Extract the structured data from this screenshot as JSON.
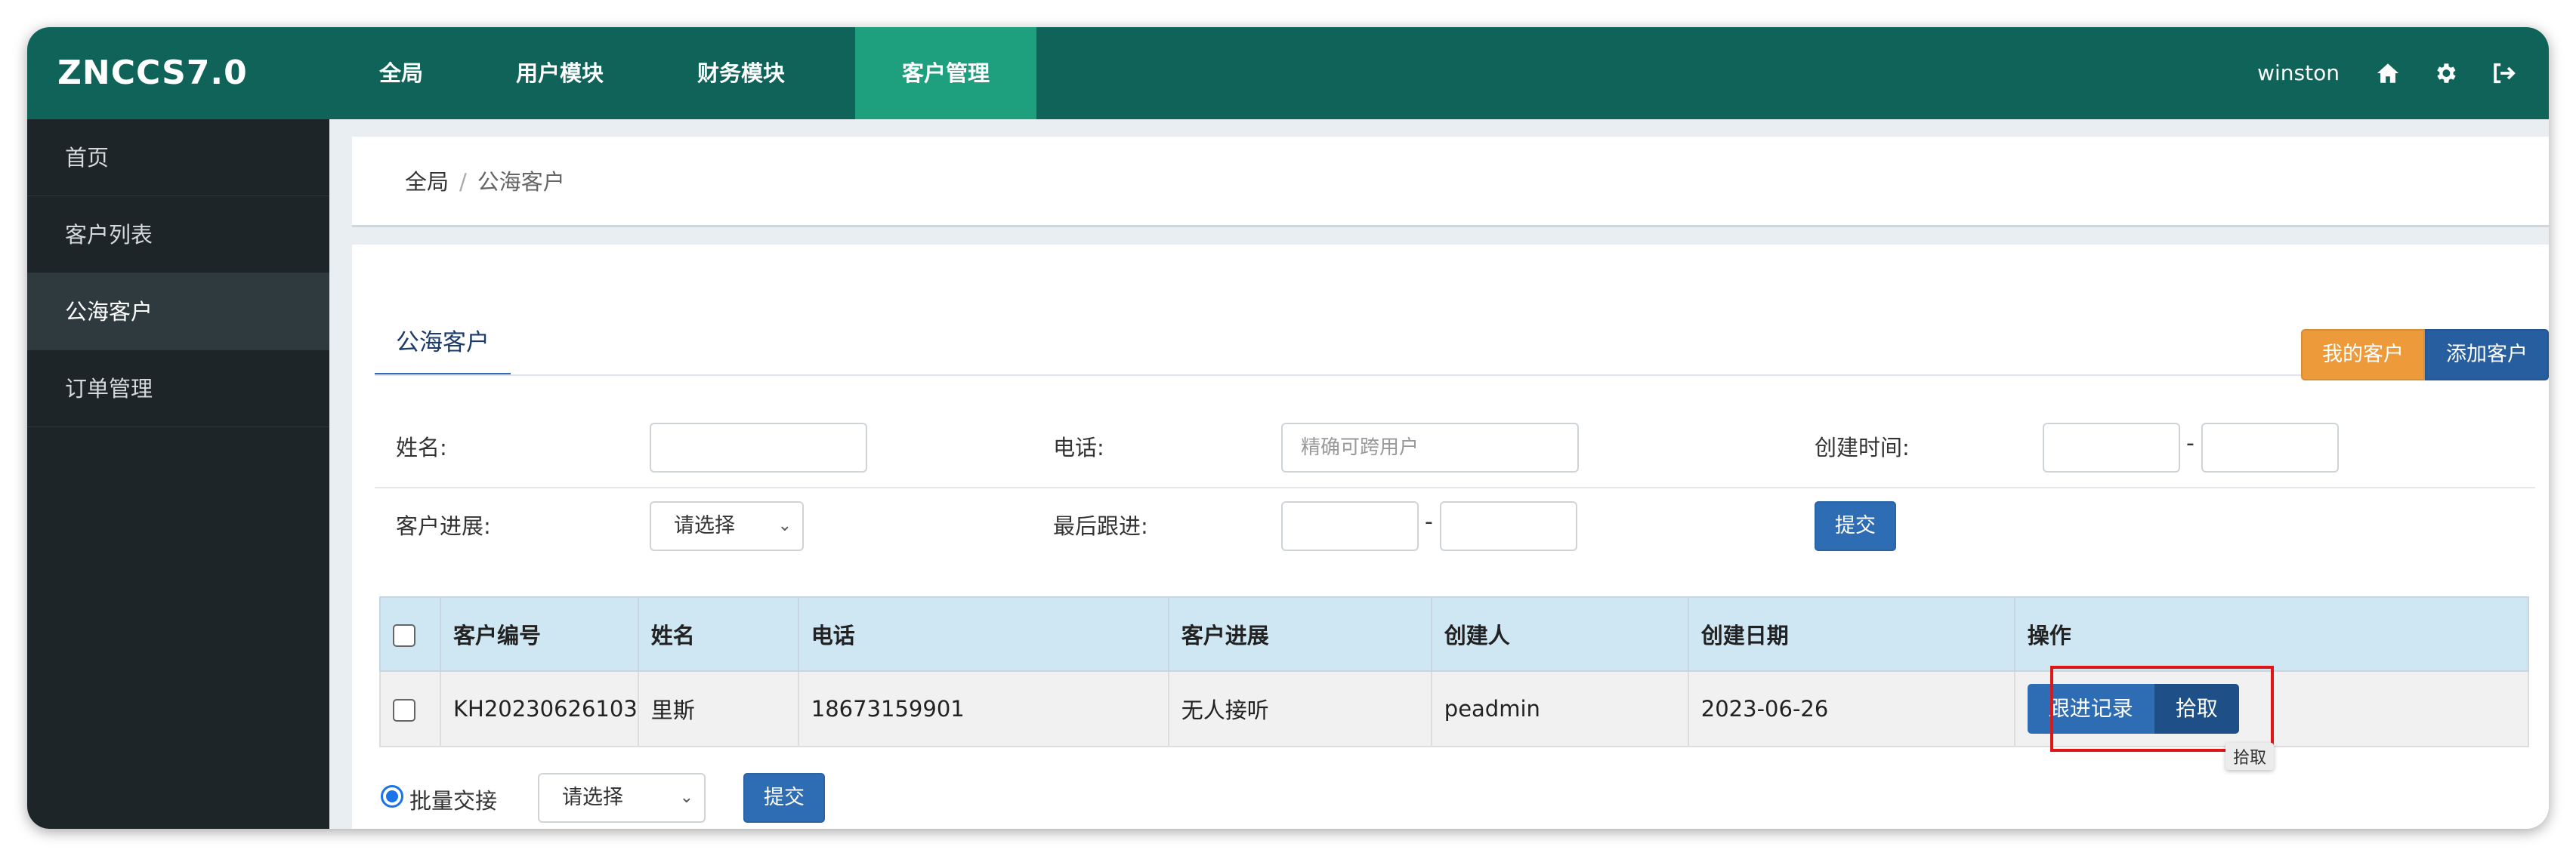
{
  "app": {
    "brand": "ZNCCS7.0",
    "user": "winston"
  },
  "nav": {
    "items": [
      "全局",
      "用户模块",
      "财务模块",
      "客户管理"
    ],
    "active_index": 3
  },
  "top_icons": [
    "home-icon",
    "gear-icon",
    "logout-icon"
  ],
  "sidebar": {
    "items": [
      "首页",
      "客户列表",
      "公海客户",
      "订单管理"
    ],
    "active_index": 2
  },
  "breadcrumb": {
    "home": "全局",
    "separator": "/",
    "current": "公海客户"
  },
  "page": {
    "tab": "公海客户",
    "my_customers_button": "我的客户",
    "add_customer_button": "添加客户"
  },
  "filters": {
    "name_label": "姓名:",
    "name_value": "",
    "phone_label": "电话:",
    "phone_placeholder": "精确可跨用户",
    "created_label": "创建时间:",
    "created_from": "",
    "created_to": "",
    "dash": "-",
    "progress_label": "客户进展:",
    "progress_selected": "请选择",
    "last_follow_label": "最后跟进:",
    "last_follow_from": "",
    "last_follow_to": "",
    "submit": "提交"
  },
  "table": {
    "headers": [
      "客户编号",
      "姓名",
      "电话",
      "客户进展",
      "创建人",
      "创建日期",
      "操作"
    ],
    "rows": [
      {
        "id": "KH20230626103",
        "name": "里斯",
        "phone": "18673159901",
        "progress": "无人接听",
        "creator": "peadmin",
        "created": "2023-06-26",
        "actions": [
          "跟进记录",
          "拾取"
        ]
      }
    ]
  },
  "tooltip": "拾取",
  "bulk": {
    "label": "批量交接",
    "selected": "请选择",
    "submit": "提交"
  },
  "colors": {
    "topbar": "#0f6359",
    "nav_active": "#1ea07f",
    "sidebar": "#1e2529",
    "primary": "#2e6db3",
    "warning": "#ec9a3a",
    "highlight": "#e01515"
  }
}
